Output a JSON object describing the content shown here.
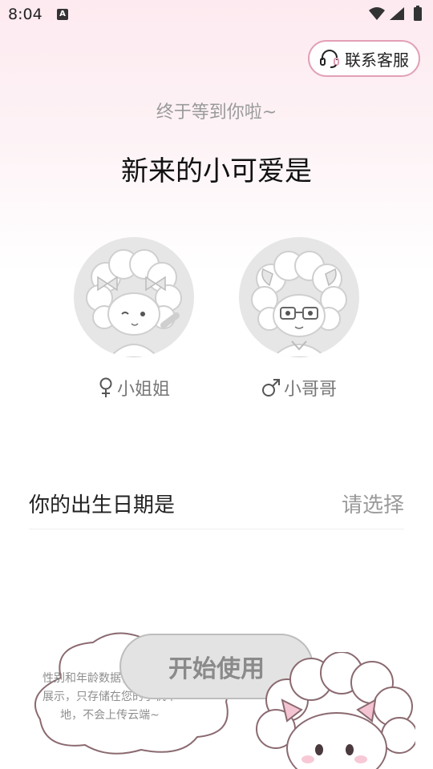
{
  "status_bar": {
    "time": "8:04",
    "notification_letter": "A"
  },
  "header": {
    "support_label": "联系客服"
  },
  "intro": {
    "subtitle": "终于等到你啦~",
    "title": "新来的小可爱是"
  },
  "gender_options": [
    {
      "label": "小姐姐",
      "icon": "female-icon"
    },
    {
      "label": "小哥哥",
      "icon": "male-icon"
    }
  ],
  "birth": {
    "label": "你的出生日期是",
    "placeholder": "请选择"
  },
  "privacy_note": "性别和年龄数据仅用于功能展示，只存储在您的手机本地，不会上传云端~",
  "start_button": "开始使用",
  "colors": {
    "accent_border": "#e2a0b6",
    "button_bg": "#e3e3e3",
    "avatar_bg": "#e6e6e6"
  }
}
